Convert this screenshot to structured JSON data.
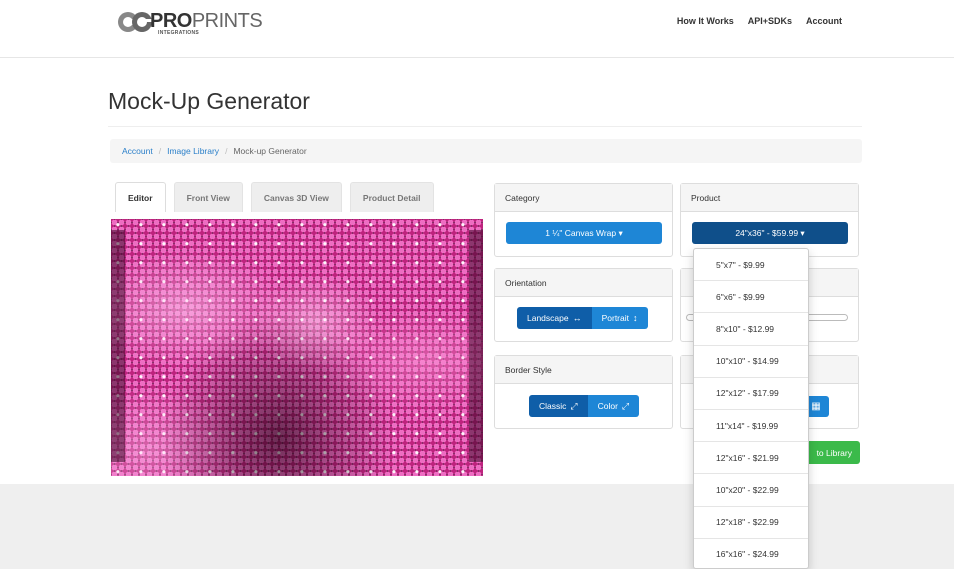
{
  "brand": {
    "logo_main": "PRO",
    "logo_secondary": "PRINTS",
    "logo_sub": "INTEGRATIONS",
    "logo_mark": "CG"
  },
  "nav": {
    "items": [
      "How It Works",
      "API+SDKs",
      "Account"
    ]
  },
  "page": {
    "title": "Mock-Up Generator"
  },
  "breadcrumb": {
    "items": [
      "Account",
      "Image Library"
    ],
    "current": "Mock-up Generator",
    "separator": "/"
  },
  "tabs": [
    {
      "label": "Editor",
      "active": true
    },
    {
      "label": "Front View",
      "active": false
    },
    {
      "label": "Canvas 3D View",
      "active": false
    },
    {
      "label": "Product Detail",
      "active": false
    }
  ],
  "category": {
    "heading": "Category",
    "selected": "1 ¼\" Canvas Wrap ▾"
  },
  "product": {
    "heading": "Product",
    "selected": "24\"x36\" - $59.99 ▾",
    "options": [
      "5\"x7\" - $9.99",
      "6\"x6\" - $9.99",
      "8\"x10\" - $12.99",
      "10\"x10\" - $14.99",
      "12\"x12\" - $17.99",
      "11\"x14\" - $19.99",
      "12\"x16\" - $21.99",
      "10\"x20\" - $22.99",
      "12\"x18\" - $22.99",
      "16\"x16\" - $24.99"
    ]
  },
  "orientation": {
    "heading": "Orientation",
    "landscape": "Landscape",
    "landscape_glyph": "↔",
    "portrait": "Portrait",
    "portrait_glyph": "↕"
  },
  "border_style": {
    "heading": "Border Style",
    "classic": "Classic",
    "color": "Color",
    "glyph": "⤢"
  },
  "actions": {
    "add_to_library": "to Library",
    "grid_glyph": "▦"
  },
  "colors": {
    "primary": "#1e86d6",
    "primary_dark": "#0f4f8a",
    "success": "#3bba4a",
    "link": "#2a7fc9"
  }
}
